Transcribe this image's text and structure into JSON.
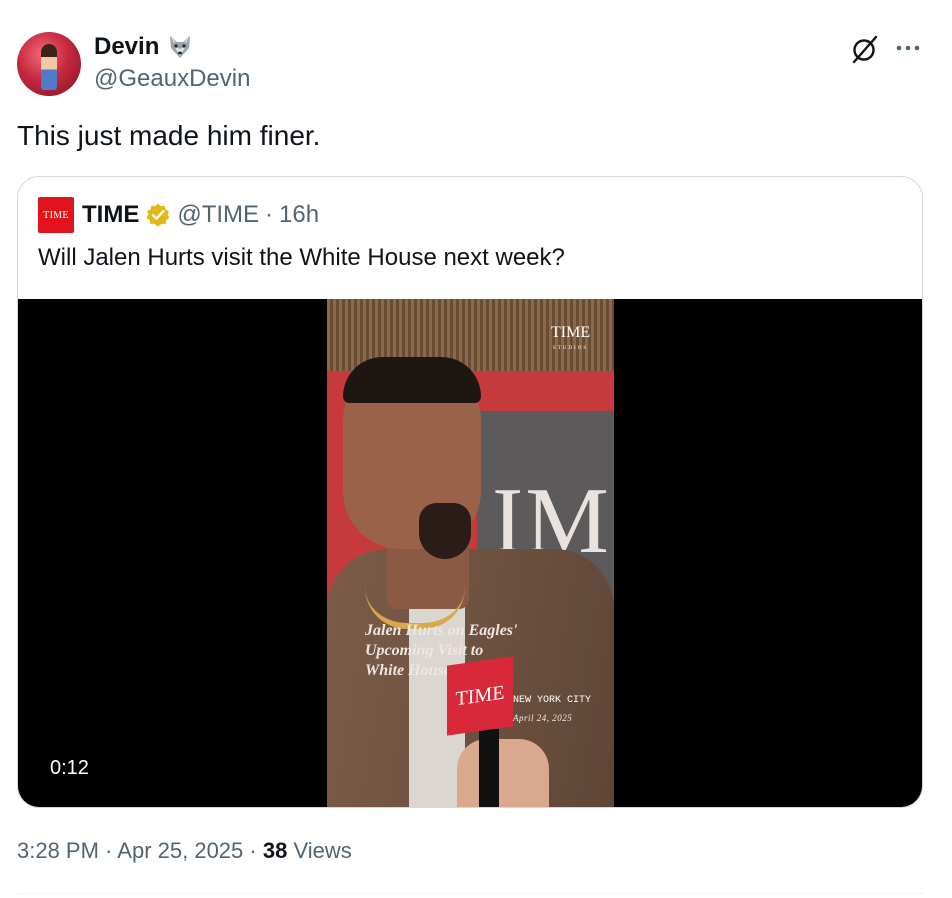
{
  "author": {
    "display_name": "Devin",
    "handle": "@GeauxDevin",
    "name_emoji": "wolf-icon"
  },
  "tweet": {
    "text": "This just made him finer."
  },
  "quoted_tweet": {
    "logo_text": "TIME",
    "name": "TIME",
    "verified": "gold-checkmark",
    "handle": "@TIME",
    "separator": "·",
    "age": "16h",
    "text": "Will Jalen Hurts visit the White House next week?",
    "video": {
      "duration": "0:12",
      "studio_title": "TIME",
      "studio_subtitle": "STUDIOS",
      "wall_text": "IM",
      "mic_label": "TIME",
      "caption": "Jalen Hurts on Eagles'\nUpcoming Visit to\nWhite House",
      "location": "NEW YORK CITY",
      "date": "April 24, 2025"
    }
  },
  "meta": {
    "time": "3:28 PM",
    "date": "Apr 25, 2025",
    "views_count": "38",
    "views_label": "Views",
    "separator": "·"
  },
  "colors": {
    "text_primary": "#0f1419",
    "text_secondary": "#536471",
    "border": "#cfd9de",
    "verified_gold": "#e2b719",
    "time_red": "#e3131b"
  }
}
